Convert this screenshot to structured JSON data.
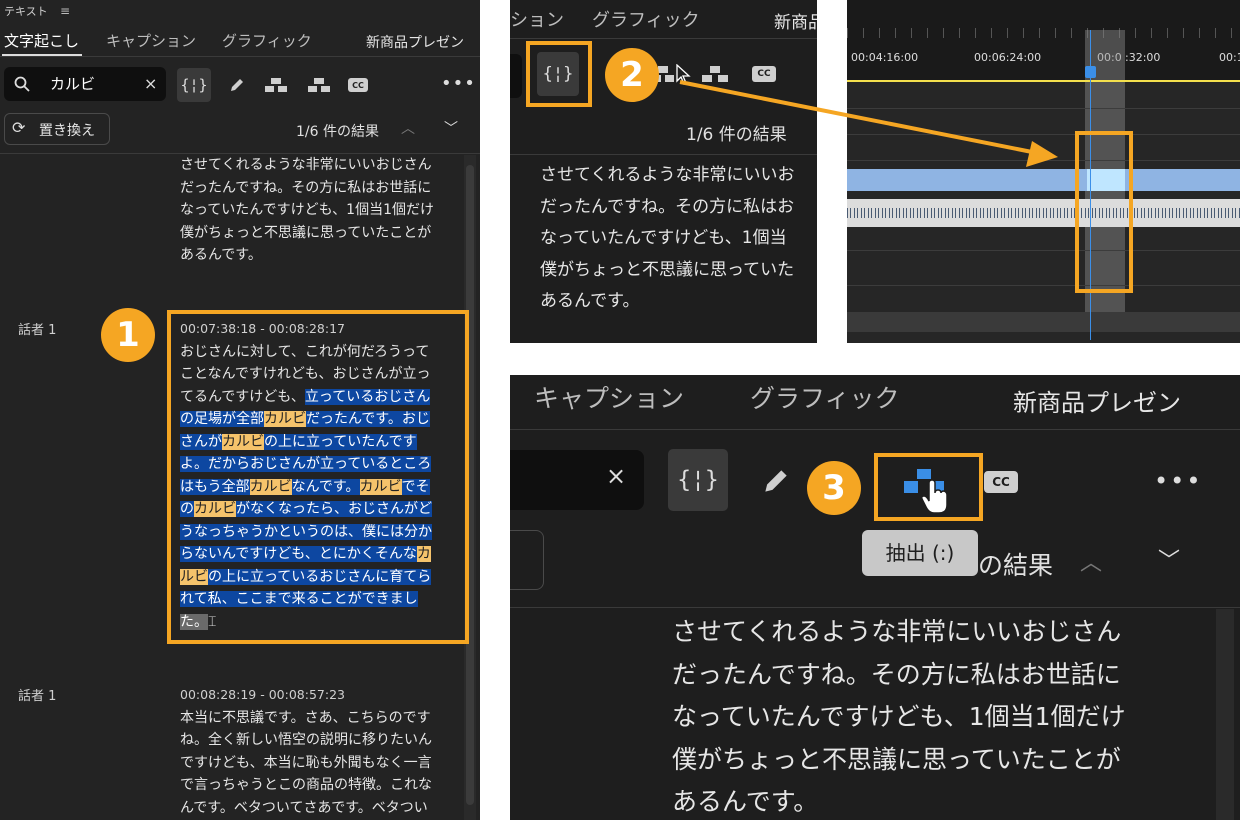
{
  "colors": {
    "accent": "#f5a623",
    "panel_bg": "#1e1e1e",
    "highlight": "#0d47a1",
    "keyword": "#f5c36b",
    "audio": "#8fb4e3"
  },
  "left": {
    "panel_title": "テキスト",
    "menu_icon": "hamburger-icon",
    "tabs": [
      "文字起こし",
      "キャプション",
      "グラフィック"
    ],
    "sequence_name": "新商品プレゼン",
    "search_value": "カルビ",
    "search_clear": "×",
    "replace_label": "置き換え",
    "results": "1/6 件の結果",
    "block0_lines": [
      "させてくれるような非常にいいおじさん",
      "だったんですね。その方に私はお世話に",
      "なっていたんですけども、1個当1個だけ",
      "僕がちょっと不思議に思っていたことが",
      "あるんです。"
    ],
    "speaker1": "話者 1",
    "time1": "00:07:38:18 - 00:08:28:17",
    "b1": {
      "l1": "おじさんに対して、これが何だろうって",
      "l2": "ことなんですけれども、おじさんが立っ",
      "l3a": "てるんですけども、",
      "l3b": "立っているおじさん",
      "l4a": "の足場が全部",
      "l4b": "カルビ",
      "l4c": "だったんです。おじ",
      "l5a": "さんが",
      "l5b": "カルビ",
      "l5c": "の上に立っていたんです",
      "l6": "よ。だからおじさんが立っているところ",
      "l7a": "はもう全部",
      "l7b": "カルビ",
      "l7c": "なんです。",
      "l7d": "カルビ",
      "l7e": "でそ",
      "l8a": "の",
      "l8b": "カルビ",
      "l8c": "がなくなったら、おじさんがど",
      "l9": "うなっちゃうかというのは、僕には分か",
      "l10a": "らないんですけども、とにかくそんな",
      "l10b": "カ",
      "l11a": "ルビ",
      "l11b": "の上に立っているおじさんに育てら",
      "l12": "れて私、ここまで来ることができまし",
      "l13": "た。"
    },
    "speaker2": "話者 1",
    "time2": "00:08:28:19 - 00:08:57:23",
    "block2_lines": [
      "本当に不思議です。さあ、こちらのです",
      "ね。全く新しい悟空の説明に移りたいん",
      "ですけども、本当に恥も外聞もなく一言",
      "で言っちゃうとこの商品の特徴。これな",
      "んです。ベタついてさあです。ベタつい"
    ]
  },
  "mid": {
    "tabs_partial": [
      "ション",
      "グラフィック"
    ],
    "sequence_partial": "新商品",
    "results": "1/6 件の結果",
    "lines": [
      "させてくれるような非常にいいお",
      "だったんですね。その方に私はお",
      "なっていたんですけども、1個当",
      "僕がちょっと不思議に思っていた",
      "あるんです。"
    ]
  },
  "timeline": {
    "timecodes": [
      "00:04:16:00",
      "00:06:24:00",
      "00:0",
      ":32:00",
      "00:1"
    ]
  },
  "zoom": {
    "tabs": [
      "キャプション",
      "グラフィック"
    ],
    "sequence_name": "新商品プレゼン",
    "search_clear": "×",
    "tooltip": "抽出 (:)",
    "results_partial": "の結果",
    "lines": [
      "させてくれるような非常にいいおじさん",
      "だったんですね。その方に私はお世話に",
      "なっていたんですけども、1個当1個だけ",
      "僕がちょっと不思議に思っていたことが",
      "あるんです。"
    ]
  },
  "badges": [
    "1",
    "2",
    "3"
  ]
}
